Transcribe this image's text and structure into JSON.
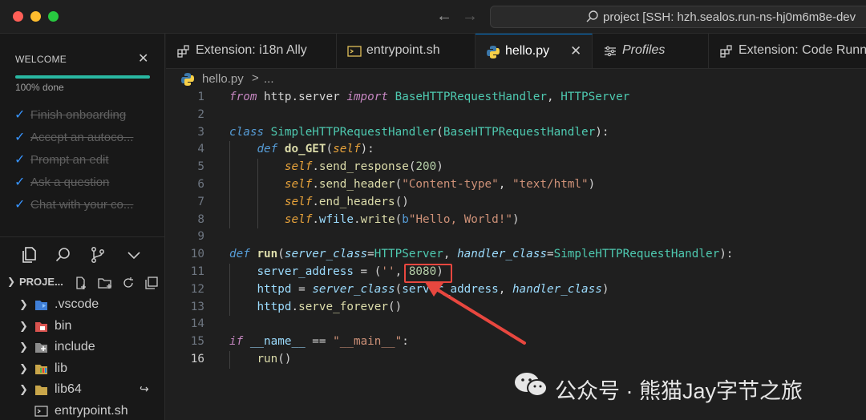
{
  "window": {
    "command_center": "project [SSH: hzh.sealos.run-ns-hj0m6m8e-dev"
  },
  "sidebar": {
    "welcome": {
      "title": "WELCOME",
      "progress_text": "100% done",
      "progress_percent": 100,
      "steps": [
        "Finish onboarding",
        "Accept an autoco...",
        "Prompt an edit",
        "Ask a question",
        "Chat with your co..."
      ]
    },
    "explorer": {
      "title": "PROJE...",
      "items": [
        {
          "name": ".vscode",
          "icon": "vscode-folder-icon",
          "badge": ""
        },
        {
          "name": "bin",
          "icon": "bin-folder-icon",
          "badge": ""
        },
        {
          "name": "include",
          "icon": "include-folder-icon",
          "badge": ""
        },
        {
          "name": "lib",
          "icon": "lib-folder-icon",
          "badge": ""
        },
        {
          "name": "lib64",
          "icon": "folder-icon",
          "badge": "↪"
        },
        {
          "name": "entrypoint.sh",
          "icon": "shell-file-icon",
          "badge": ""
        }
      ]
    }
  },
  "tabs": [
    {
      "label": "Extension: i18n Ally",
      "icon": "extension-icon"
    },
    {
      "label": "entrypoint.sh",
      "icon": "shell-file-icon"
    },
    {
      "label": "hello.py",
      "icon": "python-icon",
      "active": true
    },
    {
      "label": "Profiles",
      "icon": "profiles-icon"
    },
    {
      "label": "Extension: Code Runn",
      "icon": "extension-icon"
    }
  ],
  "breadcrumb": {
    "file": "hello.py",
    "separator": ">",
    "rest": "..."
  },
  "editor": {
    "line_numbers": [
      "1",
      "2",
      "3",
      "4",
      "5",
      "6",
      "7",
      "8",
      "9",
      "10",
      "11",
      "12",
      "13",
      "14",
      "15",
      "16"
    ],
    "current_line": 16
  },
  "watermark": "公众号 · 熊猫Jay字节之旅",
  "colors": {
    "accent": "#0078d4",
    "progress": "#29b8a2",
    "annotation": "#e8473f"
  }
}
